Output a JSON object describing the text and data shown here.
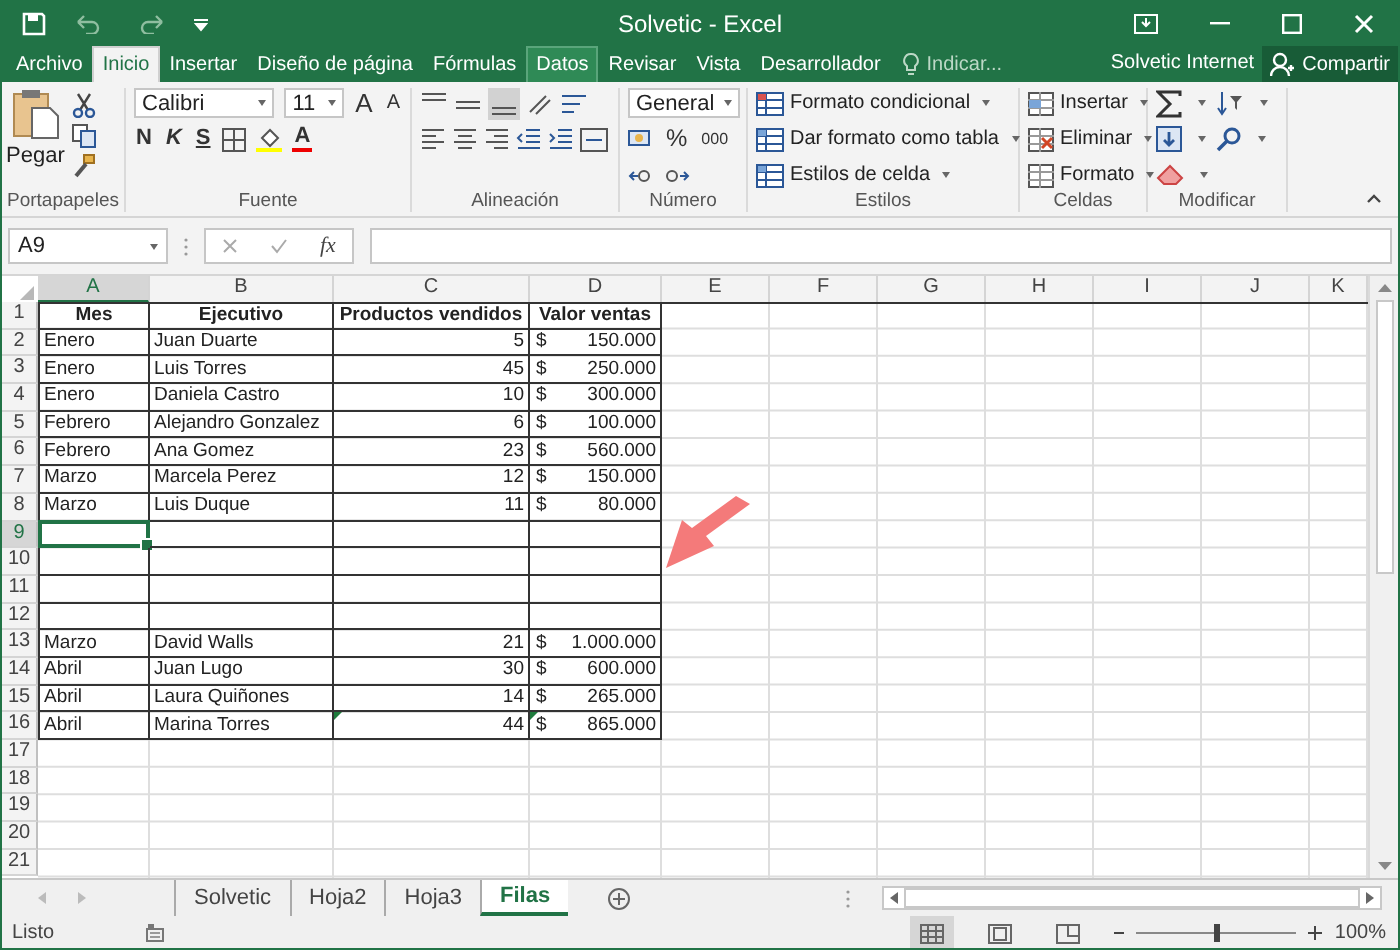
{
  "title_bar": {
    "title": "Solvetic - Excel"
  },
  "tabs": [
    {
      "label": "Archivo",
      "selected": false,
      "highlighted": false
    },
    {
      "label": "Inicio",
      "selected": true,
      "highlighted": false
    },
    {
      "label": "Insertar",
      "selected": false,
      "highlighted": false
    },
    {
      "label": "Diseño de página",
      "selected": false,
      "highlighted": false
    },
    {
      "label": "Fórmulas",
      "selected": false,
      "highlighted": false
    },
    {
      "label": "Datos",
      "selected": false,
      "highlighted": true
    },
    {
      "label": "Revisar",
      "selected": false,
      "highlighted": false
    },
    {
      "label": "Vista",
      "selected": false,
      "highlighted": false
    },
    {
      "label": "Desarrollador",
      "selected": false,
      "highlighted": false
    }
  ],
  "tell_me": {
    "placeholder": "Indicar..."
  },
  "account": "Solvetic Internet",
  "share_button": "Compartir",
  "ribbon": {
    "clipboard": {
      "label": "Portapapeles",
      "paste": "Pegar"
    },
    "font": {
      "label": "Fuente",
      "font_name": "Calibri",
      "font_size": "11",
      "grow_font": "A",
      "shrink_font": "A",
      "bold": "N",
      "italic": "K",
      "underline": "S",
      "font_color": "A"
    },
    "alignment": {
      "label": "Alineación"
    },
    "number": {
      "label": "Número",
      "format": "General",
      "percent": "%",
      "thousands": "000"
    },
    "styles": {
      "label": "Estilos",
      "commands": [
        "Formato condicional",
        "Dar formato como tabla",
        "Estilos de celda"
      ]
    },
    "cells": {
      "label": "Celdas",
      "commands": [
        "Insertar",
        "Eliminar",
        "Formato"
      ]
    },
    "editing": {
      "label": "Modificar"
    }
  },
  "formula_bar": {
    "name_box": "A9",
    "function_label": "fx"
  },
  "columns": [
    {
      "label": "A",
      "kind": "text"
    },
    {
      "label": "B",
      "kind": "text"
    },
    {
      "label": "C",
      "kind": "number"
    },
    {
      "label": "D",
      "kind": "currency"
    },
    {
      "label": "E",
      "kind": "text"
    },
    {
      "label": "F",
      "kind": "text"
    },
    {
      "label": "G",
      "kind": "text"
    },
    {
      "label": "H",
      "kind": "text"
    },
    {
      "label": "I",
      "kind": "text"
    },
    {
      "label": "J",
      "kind": "text"
    },
    {
      "label": "K",
      "kind": "text"
    }
  ],
  "rows": [
    {
      "number": "1",
      "kind": "header",
      "cells": [
        {
          "text": "Mes",
          "selected": false,
          "marked": false
        },
        {
          "text": "Ejecutivo",
          "selected": false,
          "marked": false
        },
        {
          "text": "Productos vendidos",
          "selected": false,
          "marked": false
        },
        {
          "text": "Valor ventas",
          "selected": false,
          "marked": false
        }
      ]
    },
    {
      "number": "2",
      "kind": "data",
      "cells": [
        {
          "text": "Enero",
          "selected": false,
          "marked": false
        },
        {
          "text": "Juan Duarte",
          "selected": false,
          "marked": false
        },
        {
          "text": "5",
          "selected": false,
          "marked": false
        },
        {
          "currency": "$",
          "text": "150.000",
          "selected": false,
          "marked": false
        }
      ]
    },
    {
      "number": "3",
      "kind": "data",
      "cells": [
        {
          "text": "Enero",
          "selected": false,
          "marked": false
        },
        {
          "text": "Luis Torres",
          "selected": false,
          "marked": false
        },
        {
          "text": "45",
          "selected": false,
          "marked": false
        },
        {
          "currency": "$",
          "text": "250.000",
          "selected": false,
          "marked": false
        }
      ]
    },
    {
      "number": "4",
      "kind": "data",
      "cells": [
        {
          "text": "Enero",
          "selected": false,
          "marked": false
        },
        {
          "text": "Daniela Castro",
          "selected": false,
          "marked": false
        },
        {
          "text": "10",
          "selected": false,
          "marked": false
        },
        {
          "currency": "$",
          "text": "300.000",
          "selected": false,
          "marked": false
        }
      ]
    },
    {
      "number": "5",
      "kind": "data",
      "cells": [
        {
          "text": "Febrero",
          "selected": false,
          "marked": false
        },
        {
          "text": "Alejandro Gonzalez",
          "selected": false,
          "marked": false
        },
        {
          "text": "6",
          "selected": false,
          "marked": false
        },
        {
          "currency": "$",
          "text": "100.000",
          "selected": false,
          "marked": false
        }
      ]
    },
    {
      "number": "6",
      "kind": "data",
      "cells": [
        {
          "text": "Febrero",
          "selected": false,
          "marked": false
        },
        {
          "text": "Ana Gomez",
          "selected": false,
          "marked": false
        },
        {
          "text": "23",
          "selected": false,
          "marked": false
        },
        {
          "currency": "$",
          "text": "560.000",
          "selected": false,
          "marked": false
        }
      ]
    },
    {
      "number": "7",
      "kind": "data",
      "cells": [
        {
          "text": "Marzo",
          "selected": false,
          "marked": false
        },
        {
          "text": "Marcela Perez",
          "selected": false,
          "marked": false
        },
        {
          "text": "12",
          "selected": false,
          "marked": false
        },
        {
          "currency": "$",
          "text": "150.000",
          "selected": false,
          "marked": false
        }
      ]
    },
    {
      "number": "8",
      "kind": "data",
      "cells": [
        {
          "text": "Marzo",
          "selected": false,
          "marked": false
        },
        {
          "text": "Luis Duque",
          "selected": false,
          "marked": false
        },
        {
          "text": "11",
          "selected": false,
          "marked": false
        },
        {
          "currency": "$",
          "text": "80.000",
          "selected": false,
          "marked": false
        }
      ]
    },
    {
      "number": "9",
      "kind": "data",
      "cells": [
        {
          "selected": true,
          "marked": false
        },
        {
          "selected": false,
          "marked": false
        },
        {
          "selected": false,
          "marked": false
        },
        {
          "selected": false,
          "marked": false
        }
      ]
    },
    {
      "number": "10",
      "kind": "data",
      "cells": [
        {
          "selected": false,
          "marked": false
        },
        {
          "selected": false,
          "marked": false
        },
        {
          "selected": false,
          "marked": false
        },
        {
          "selected": false,
          "marked": false
        }
      ]
    },
    {
      "number": "11",
      "kind": "data",
      "cells": [
        {
          "selected": false,
          "marked": false
        },
        {
          "selected": false,
          "marked": false
        },
        {
          "selected": false,
          "marked": false
        },
        {
          "selected": false,
          "marked": false
        }
      ]
    },
    {
      "number": "12",
      "kind": "data",
      "cells": [
        {
          "selected": false,
          "marked": false
        },
        {
          "selected": false,
          "marked": false
        },
        {
          "selected": false,
          "marked": false
        },
        {
          "selected": false,
          "marked": false
        }
      ]
    },
    {
      "number": "13",
      "kind": "data",
      "cells": [
        {
          "text": "Marzo",
          "selected": false,
          "marked": false
        },
        {
          "text": "David Walls",
          "selected": false,
          "marked": false
        },
        {
          "text": "21",
          "selected": false,
          "marked": false
        },
        {
          "currency": "$",
          "text": "1.000.000",
          "selected": false,
          "marked": false
        }
      ]
    },
    {
      "number": "14",
      "kind": "data",
      "cells": [
        {
          "text": "Abril",
          "selected": false,
          "marked": false
        },
        {
          "text": "Juan Lugo",
          "selected": false,
          "marked": false
        },
        {
          "text": "30",
          "selected": false,
          "marked": false
        },
        {
          "currency": "$",
          "text": "600.000",
          "selected": false,
          "marked": false
        }
      ]
    },
    {
      "number": "15",
      "kind": "data",
      "cells": [
        {
          "text": "Abril",
          "selected": false,
          "marked": false
        },
        {
          "text": "Laura Quiñones",
          "selected": false,
          "marked": false
        },
        {
          "text": "14",
          "selected": false,
          "marked": false
        },
        {
          "currency": "$",
          "text": "265.000",
          "selected": false,
          "marked": false
        }
      ]
    },
    {
      "number": "16",
      "kind": "data",
      "cells": [
        {
          "text": "Abril",
          "selected": false,
          "marked": false
        },
        {
          "text": "Marina Torres",
          "selected": false,
          "marked": false
        },
        {
          "text": "44",
          "selected": false,
          "marked": true
        },
        {
          "currency": "$",
          "text": "865.000",
          "selected": false,
          "marked": true
        }
      ]
    },
    {
      "number": "17",
      "kind": "data"
    },
    {
      "number": "18",
      "kind": "data"
    },
    {
      "number": "19",
      "kind": "data"
    },
    {
      "number": "20",
      "kind": "data"
    },
    {
      "number": "21",
      "kind": "data"
    }
  ],
  "sheet_tabs": [
    {
      "label": "Solvetic",
      "selected": false
    },
    {
      "label": "Hoja2",
      "selected": false
    },
    {
      "label": "Hoja3",
      "selected": false
    },
    {
      "label": "Filas",
      "selected": true
    }
  ],
  "status_bar": {
    "status": "Listo",
    "zoom": "100%",
    "zoom_slider": {
      "level": 0.5
    }
  },
  "view_buttons": [
    {
      "kind": "normal",
      "selected": true
    },
    {
      "kind": "page_layout",
      "selected": false
    },
    {
      "kind": "page_break",
      "selected": false
    }
  ]
}
